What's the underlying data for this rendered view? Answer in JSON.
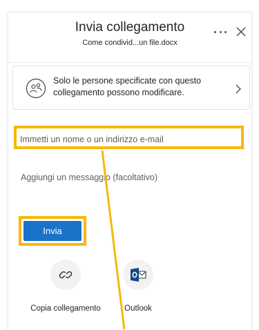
{
  "header": {
    "title": "Invia collegamento",
    "subtitle": "Come condivid...un file.docx"
  },
  "permissions": {
    "text": "Solo le persone specificate con questo collegamento possono modificare."
  },
  "recipients": {
    "placeholder": "Immetti un nome o un indirizzo e-mail",
    "value": ""
  },
  "message": {
    "placeholder": "Aggiungi un messaggio (facoltativo)",
    "value": ""
  },
  "actions": {
    "send_label": "Invia"
  },
  "share_options": [
    {
      "label": "Copia collegamento",
      "icon": "link-icon"
    },
    {
      "label": "Outlook",
      "icon": "outlook-icon"
    }
  ],
  "colors": {
    "accent": "#1b72c9",
    "highlight": "#f8b800",
    "outlook_brand": "#0f4a85"
  }
}
